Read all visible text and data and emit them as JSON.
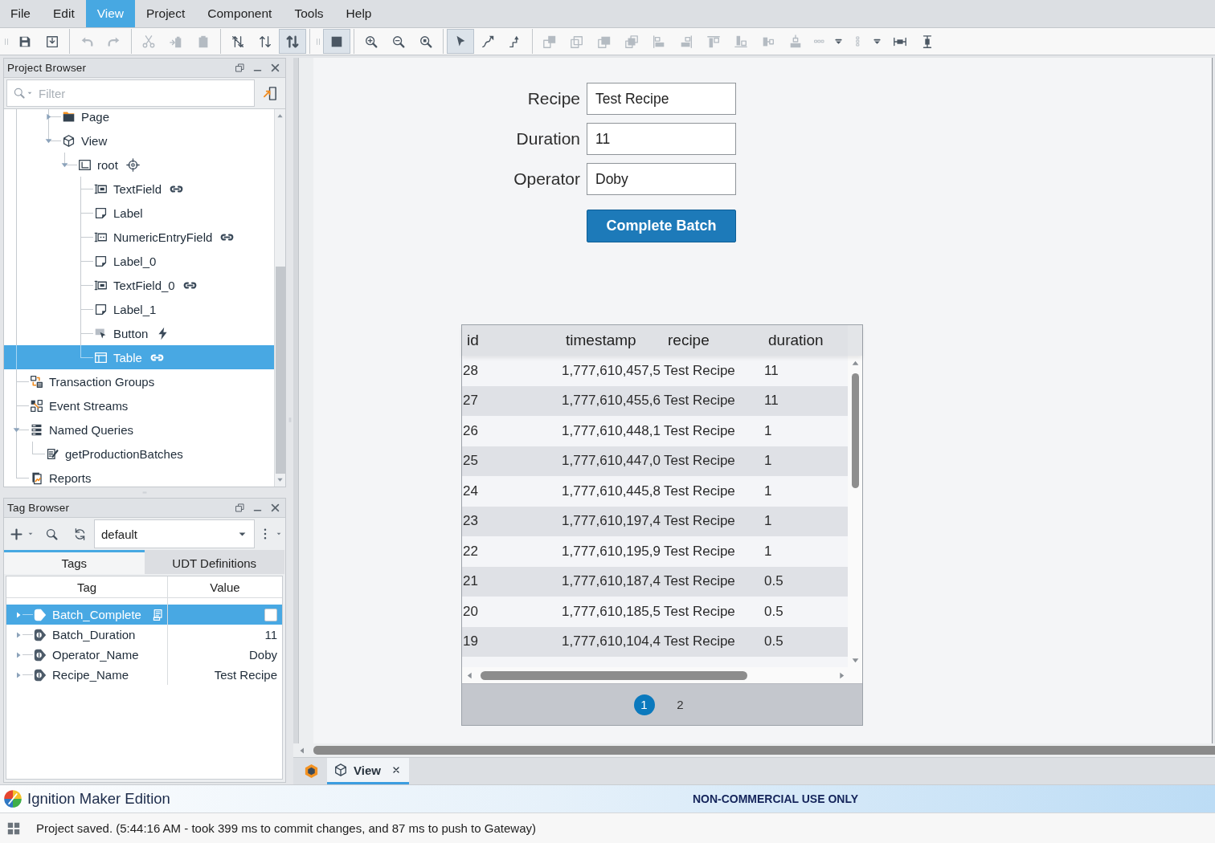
{
  "menu_bar": [
    {
      "label": "File",
      "selected": false
    },
    {
      "label": "Edit",
      "selected": false
    },
    {
      "label": "View",
      "selected": true
    },
    {
      "label": "Project",
      "selected": false
    },
    {
      "label": "Component",
      "selected": false
    },
    {
      "label": "Tools",
      "selected": false
    },
    {
      "label": "Help",
      "selected": false
    }
  ],
  "toolbar": {
    "groups": [
      {
        "grip": true,
        "buttons": [
          {
            "kind": "save",
            "pressed": false,
            "disabled": false
          },
          {
            "kind": "save_all",
            "pressed": false,
            "disabled": false
          }
        ]
      },
      {
        "grip": false,
        "buttons": [
          {
            "kind": "undo",
            "pressed": false,
            "disabled": true
          },
          {
            "kind": "redo",
            "pressed": false,
            "disabled": true
          }
        ]
      },
      {
        "grip": false,
        "buttons": [
          {
            "kind": "cut",
            "pressed": false,
            "disabled": true
          },
          {
            "kind": "paste_into",
            "pressed": false,
            "disabled": true
          },
          {
            "kind": "clipboard",
            "pressed": false,
            "disabled": true
          }
        ]
      },
      {
        "grip": false,
        "buttons": [
          {
            "kind": "no_swap",
            "pressed": false,
            "disabled": false
          },
          {
            "kind": "swap",
            "pressed": false,
            "disabled": false
          },
          {
            "kind": "swap_bold",
            "pressed": true,
            "disabled": false
          }
        ]
      },
      {
        "grip": true,
        "buttons": [
          {
            "kind": "stop",
            "pressed": true,
            "disabled": false
          }
        ]
      },
      {
        "grip": false,
        "buttons": [
          {
            "kind": "zoom_in",
            "pressed": false,
            "disabled": false
          },
          {
            "kind": "zoom_out",
            "pressed": false,
            "disabled": false
          },
          {
            "kind": "zoom_fit",
            "pressed": false,
            "disabled": false
          }
        ]
      },
      {
        "grip": false,
        "buttons": [
          {
            "kind": "pointer",
            "pressed": true,
            "disabled": false
          },
          {
            "kind": "connect",
            "pressed": false,
            "disabled": false
          },
          {
            "kind": "connect_alt",
            "pressed": false,
            "disabled": false
          }
        ]
      },
      {
        "grip": false,
        "buttons": [
          {
            "kind": "layer_forward",
            "pressed": false,
            "disabled": true
          },
          {
            "kind": "layer_backward",
            "pressed": false,
            "disabled": true
          },
          {
            "kind": "layer_front",
            "pressed": false,
            "disabled": true
          },
          {
            "kind": "layer_back",
            "pressed": false,
            "disabled": true
          },
          {
            "kind": "align_left",
            "pressed": false,
            "disabled": true
          },
          {
            "kind": "align_right",
            "pressed": false,
            "disabled": true
          },
          {
            "kind": "align_top",
            "pressed": false,
            "disabled": true
          },
          {
            "kind": "align_bottom",
            "pressed": false,
            "disabled": true
          },
          {
            "kind": "align_middle",
            "pressed": false,
            "disabled": true
          },
          {
            "kind": "align_center",
            "pressed": false,
            "disabled": true
          },
          {
            "kind": "distribute_h",
            "pressed": false,
            "disabled": true
          },
          {
            "kind": "dropdown",
            "pressed": false,
            "disabled": false
          },
          {
            "kind": "distribute_v",
            "pressed": false,
            "disabled": true
          },
          {
            "kind": "dropdown",
            "pressed": false,
            "disabled": false
          },
          {
            "kind": "match_width",
            "pressed": false,
            "disabled": false
          },
          {
            "kind": "match_height",
            "pressed": false,
            "disabled": false
          }
        ]
      }
    ]
  },
  "project_browser": {
    "title": "Project Browser",
    "filter": {
      "placeholder": "Filter"
    },
    "tree": [
      {
        "children": [
          {
            "children": [
              {
                "label": "Page",
                "kind": "folder",
                "expanded": false,
                "selected": false
              },
              {
                "label": "View",
                "kind": "view",
                "expanded": true,
                "selected": false,
                "children": [
                  {
                    "label": "root",
                    "kind": "container",
                    "badge": {
                      "kind": "crosshair"
                    },
                    "expanded": true,
                    "selected": false,
                    "children": [
                      {
                        "label": "TextField",
                        "kind": "textfield",
                        "badge": {
                          "kind": "link"
                        },
                        "selected": false
                      },
                      {
                        "label": "Label",
                        "kind": "label",
                        "selected": false
                      },
                      {
                        "label": "NumericEntryField",
                        "kind": "numeric",
                        "badge": {
                          "kind": "link"
                        },
                        "selected": false
                      },
                      {
                        "label": "Label_0",
                        "kind": "label",
                        "selected": false
                      },
                      {
                        "label": "TextField_0",
                        "kind": "textfield",
                        "badge": {
                          "kind": "link"
                        },
                        "selected": false
                      },
                      {
                        "label": "Label_1",
                        "kind": "label",
                        "selected": false
                      },
                      {
                        "label": "Button",
                        "kind": "button",
                        "badge": {
                          "kind": "bolt"
                        },
                        "selected": false
                      },
                      {
                        "label": "Table",
                        "kind": "table",
                        "badge": {
                          "kind": "link"
                        },
                        "selected": true
                      }
                    ]
                  }
                ]
              }
            ]
          }
        ]
      },
      {
        "label": "Transaction Groups",
        "kind": "transaction",
        "selected": false
      },
      {
        "label": "Event Streams",
        "kind": "events",
        "selected": false
      },
      {
        "label": "Named Queries",
        "kind": "queries",
        "expanded": true,
        "selected": false,
        "children": [
          {
            "label": "getProductionBatches",
            "kind": "query",
            "selected": false
          }
        ]
      },
      {
        "label": "Reports",
        "kind": "reports",
        "selected": false
      }
    ]
  },
  "tag_browser": {
    "title": "Tag Browser",
    "provider": "default",
    "tabs": [
      {
        "label": "Tags",
        "selected": true
      },
      {
        "label": "UDT Definitions",
        "selected": false
      }
    ],
    "table": {
      "columns": [
        "Tag",
        "Value"
      ],
      "rows": [
        {
          "name": "Batch_Complete",
          "selected": true,
          "expanded": false,
          "note": true,
          "kind": "boolean",
          "checked": false
        },
        {
          "name": "Batch_Duration",
          "selected": false,
          "expanded": false,
          "note": false,
          "kind": "value",
          "value": "11"
        },
        {
          "name": "Operator_Name",
          "selected": false,
          "expanded": false,
          "note": false,
          "kind": "value",
          "value": "Doby"
        },
        {
          "name": "Recipe_Name",
          "selected": false,
          "expanded": false,
          "note": false,
          "kind": "value",
          "value": "Test Recipe"
        }
      ]
    }
  },
  "designer": {
    "form": {
      "fields": [
        {
          "label": "Recipe",
          "value": "Test Recipe"
        },
        {
          "label": "Duration",
          "value": "11"
        },
        {
          "label": "Operator",
          "value": "Doby"
        }
      ],
      "button": "Complete Batch"
    },
    "table": {
      "columns": [
        "id",
        "timestamp",
        "recipe",
        "duration"
      ],
      "rows": [
        [
          "28",
          "1,777,610,457,5",
          "Test Recipe",
          "11"
        ],
        [
          "27",
          "1,777,610,455,6",
          "Test Recipe",
          "11"
        ],
        [
          "26",
          "1,777,610,448,1",
          "Test Recipe",
          "1"
        ],
        [
          "25",
          "1,777,610,447,0",
          "Test Recipe",
          "1"
        ],
        [
          "24",
          "1,777,610,445,8",
          "Test Recipe",
          "1"
        ],
        [
          "23",
          "1,777,610,197,4",
          "Test Recipe",
          "1"
        ],
        [
          "22",
          "1,777,610,195,9",
          "Test Recipe",
          "1"
        ],
        [
          "21",
          "1,777,610,187,4",
          "Test Recipe",
          "0.5"
        ],
        [
          "20",
          "1,777,610,185,5",
          "Test Recipe",
          "0.5"
        ],
        [
          "19",
          "1,777,610,104,4",
          "Test Recipe",
          "0.5"
        ]
      ],
      "pages": [
        {
          "label": "1",
          "selected": true
        },
        {
          "label": "2",
          "selected": false
        }
      ]
    },
    "tabs": [
      {
        "label": "View",
        "selected": true
      }
    ]
  },
  "branding": {
    "product": "Ignition Maker Edition",
    "notice": "NON-COMMERCIAL USE ONLY"
  },
  "status_bar": {
    "message": "Project saved. (5:44:16 AM - took 399 ms to commit changes, and 87 ms to push to Gateway)"
  }
}
